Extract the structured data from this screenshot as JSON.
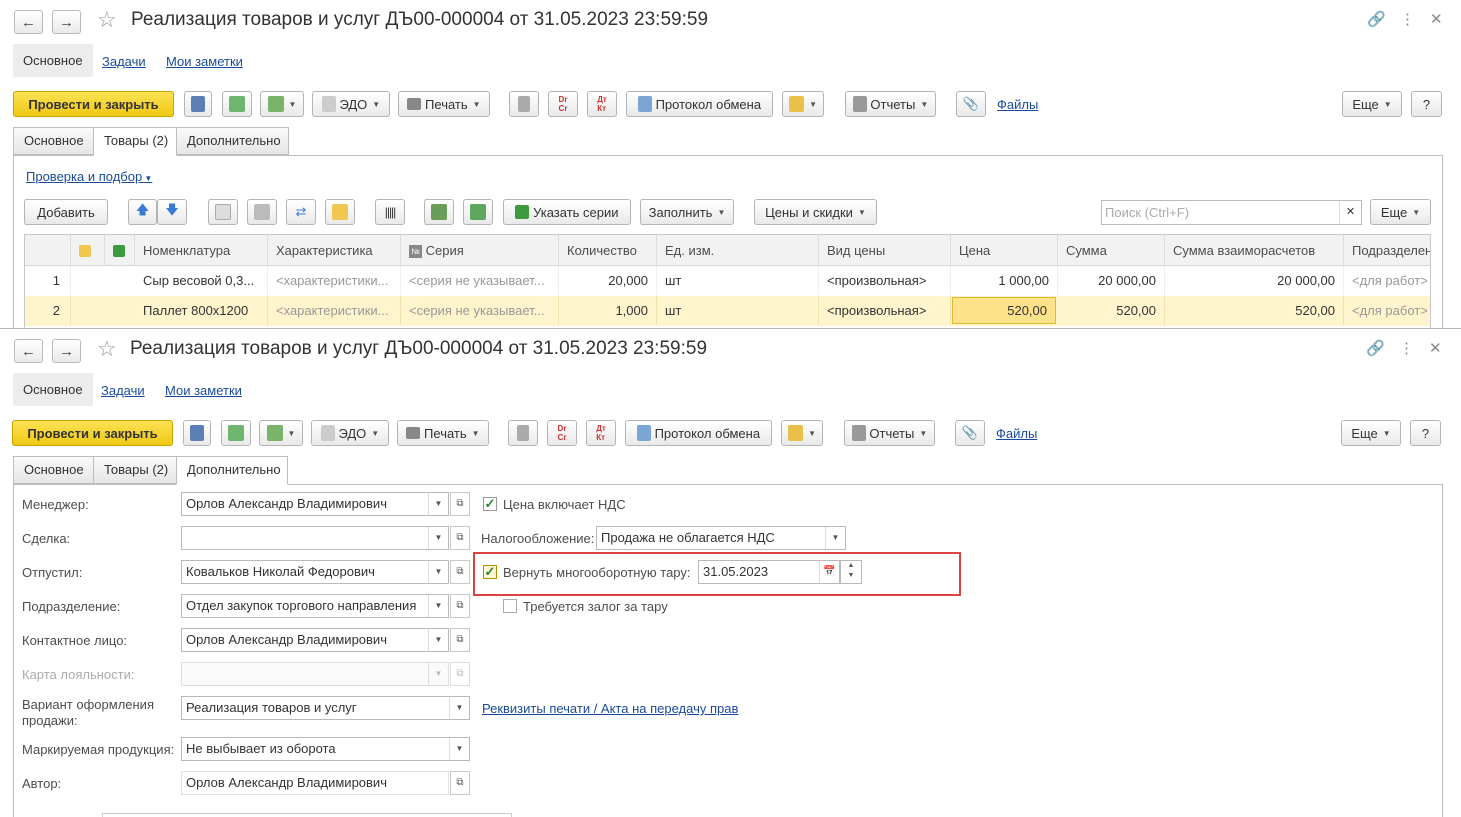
{
  "window": {
    "title": "Реализация товаров и услуг ДЪ00-000004 от 31.05.2023 23:59:59",
    "nav_tabs": [
      "Основное",
      "Задачи",
      "Мои заметки"
    ]
  },
  "toolbar": {
    "post_close": "Провести и закрыть",
    "edo": "ЭДО",
    "print": "Печать",
    "exchange_log": "Протокол обмена",
    "reports": "Отчеты",
    "files": "Файлы",
    "more": "Еще",
    "help": "?"
  },
  "tabs": [
    "Основное",
    "Товары (2)",
    "Дополнительно"
  ],
  "goods": {
    "check_link": "Проверка и подбор",
    "add": "Добавить",
    "set_series": "Указать серии",
    "fill": "Заполнить",
    "prices": "Цены и скидки",
    "search_placeholder": "Поиск (Ctrl+F)",
    "more": "Еще",
    "columns": [
      "Номенклатура",
      "Характеристика",
      "Серия",
      "Количество",
      "Ед. изм.",
      "Вид цены",
      "Цена",
      "Сумма",
      "Сумма взаиморасчетов",
      "Подразделен"
    ],
    "rows": [
      {
        "n": "1",
        "item": "Сыр весовой 0,3...",
        "char": "<характеристики...",
        "series": "<серия не указывает...",
        "qty": "20,000",
        "unit": "шт",
        "price_type": "<произвольная>",
        "price": "1 000,00",
        "sum": "20 000,00",
        "settle": "20 000,00",
        "dept": "<для работ>"
      },
      {
        "n": "2",
        "item": "Паллет 800х1200",
        "char": "<характеристики...",
        "series": "<серия не указывает...",
        "qty": "1,000",
        "unit": "шт",
        "price_type": "<произвольная>",
        "price": "520,00",
        "sum": "520,00",
        "settle": "520,00",
        "dept": "<для работ>"
      }
    ]
  },
  "extra": {
    "manager_label": "Менеджер:",
    "manager": "Орлов Александр Владимирович",
    "deal_label": "Сделка:",
    "deal": "",
    "released_label": "Отпустил:",
    "released": "Ковальков Николай Федорович",
    "dept_label": "Подразделение:",
    "dept": "Отдел закупок торгового направления",
    "contact_label": "Контактное лицо:",
    "contact": "Орлов Александр Владимирович",
    "loyalty_label": "Карта лояльности:",
    "variant_label": "Вариант оформления продажи:",
    "variant": "Реализация товаров и услуг",
    "marked_label": "Маркируемая продукция:",
    "marked": "Не выбывает из оборота",
    "author_label": "Автор:",
    "author": "Орлов Александр Владимирович",
    "price_vat": "Цена включает НДС",
    "tax_label": "Налогообложение:",
    "tax": "Продажа не облагается НДС",
    "return_tare": "Вернуть многооборотную тару:",
    "return_date": "31.05.2023",
    "deposit": "Требуется залог за тару",
    "print_link": "Реквизиты печати / Акта на передачу прав"
  },
  "colors": {
    "accent_yellow": "#f5d22a",
    "link": "#1a4b9b",
    "highlight_red": "#d9453f",
    "row_selected": "#fff4cc"
  }
}
